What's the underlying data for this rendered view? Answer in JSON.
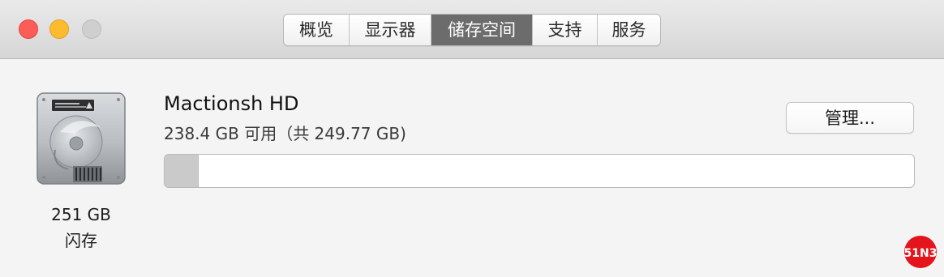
{
  "window": {
    "controls": [
      "close",
      "minimize",
      "maximize"
    ]
  },
  "tabs": [
    {
      "label": "概览",
      "active": false
    },
    {
      "label": "显示器",
      "active": false
    },
    {
      "label": "储存空间",
      "active": true
    },
    {
      "label": "支持",
      "active": false
    },
    {
      "label": "服务",
      "active": false
    }
  ],
  "disk": {
    "icon": "hard-drive-icon",
    "capacity": "251 GB",
    "type": "闪存",
    "name": "Mactionsh HD",
    "usage": "238.4 GB 可用（共 249.77 GB)",
    "used_fraction": 0.045
  },
  "buttons": {
    "manage_label": "管理..."
  },
  "watermark": {
    "text": "51N3",
    "color": "#e3141c"
  },
  "colors": {
    "active_tab": "#6c6c6c",
    "close": "#fc5d56",
    "minimize": "#fdbb2d",
    "maximize": "#cfcfcf",
    "storage_fill": "#cacaca"
  }
}
